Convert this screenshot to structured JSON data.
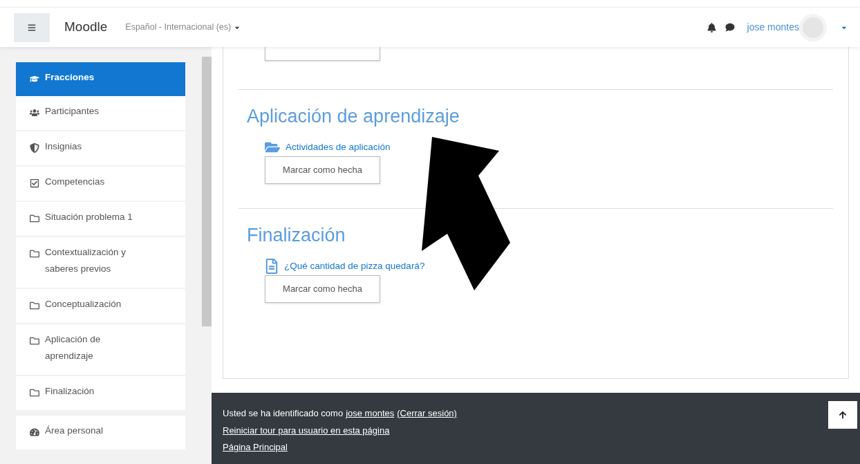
{
  "navbar": {
    "brand": "Moodle",
    "language": "Español - Internacional (es)",
    "user_name": "jose montes"
  },
  "sidebar": {
    "items": [
      {
        "label": "Fracciones",
        "kind": "course",
        "selected": true
      },
      {
        "label": "Participantes",
        "kind": "users",
        "selected": false
      },
      {
        "label": "Insignias",
        "kind": "shield",
        "selected": false
      },
      {
        "label": "Competencias",
        "kind": "checkbox",
        "selected": false
      },
      {
        "label": "Situación problema 1",
        "kind": "folder",
        "selected": false
      },
      {
        "label": "Contextualización y saberes previos",
        "kind": "folder",
        "selected": false
      },
      {
        "label": "Conceptualización",
        "kind": "folder",
        "selected": false
      },
      {
        "label": "Aplicación de aprendizaje",
        "kind": "folder",
        "selected": false
      },
      {
        "label": "Finalización",
        "kind": "folder",
        "selected": false
      }
    ],
    "personal_items": [
      {
        "label": "Área personal",
        "kind": "dashboard",
        "selected": false
      }
    ]
  },
  "content": {
    "sections": [
      {
        "title": "Aplicación de aprendizaje",
        "activities": [
          {
            "name": "Actividades de aplicación",
            "kind": "folder",
            "button": "Marcar como hecha"
          }
        ]
      },
      {
        "title": "Finalización",
        "activities": [
          {
            "name": "¿Qué cantidad de pizza quedará?",
            "kind": "page",
            "button": "Marcar como hecha"
          }
        ]
      }
    ]
  },
  "footer": {
    "login_prefix": "Usted se ha identificado como",
    "user_link": "jose montes",
    "logout_link": "(Cerrar sesión)",
    "tour_link": "Reiniciar tour para usuario en esta página",
    "home_link": "Página Principal"
  }
}
